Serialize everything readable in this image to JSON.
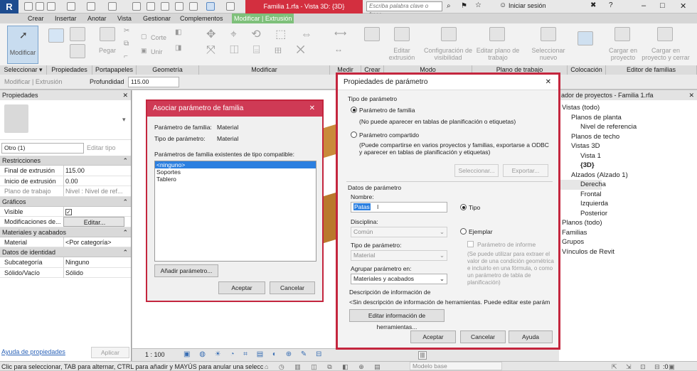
{
  "titlebar": {
    "logo": "R",
    "window_title": "Familia 1.rfa - Vista 3D: {3D}",
    "search_placeholder": "Escriba palabra clave o frase",
    "sign_in": "Iniciar sesión",
    "win_min": "–",
    "win_max": "□",
    "win_close": "✕"
  },
  "tabs": [
    "Crear",
    "Insertar",
    "Anotar",
    "Vista",
    "Gestionar",
    "Complementos",
    "Modificar | Extrusión"
  ],
  "ribbon": {
    "modify": "Modificar",
    "properties_btn": "Propiedades",
    "paste": "Pegar",
    "cut": "Corte",
    "join": "Unir",
    "edit_extrusion": "Editar extrusión",
    "visibility": "Configuración de visibilidad",
    "edit_workplane": "Editar plano de trabajo",
    "select_new": "Seleccionar nuevo",
    "load_project": "Cargar en proyecto",
    "load_close": "Cargar en proyecto y cerrar",
    "panels": [
      "Seleccionar ▾",
      "Propiedades",
      "Portapapeles",
      "Geometría",
      "Modificar",
      "Medir",
      "Crear",
      "Modo",
      "Plano de trabajo",
      "Colocación",
      "Editor de familias"
    ]
  },
  "optbar": {
    "context": "Modificar | Extrusión",
    "depth_label": "Profundidad",
    "depth_value": "115.00"
  },
  "properties": {
    "title": "Propiedades",
    "close": "✕",
    "type_selector": "Otro (1)",
    "edit_type": "Editar tipo",
    "sections": {
      "constraints": "Restricciones",
      "graphics": "Gráficos",
      "materials": "Materiales y acabados",
      "identity": "Datos de identidad"
    },
    "rows": {
      "extrusion_end": {
        "k": "Final de extrusión",
        "v": "115.00"
      },
      "extrusion_start": {
        "k": "Inicio de extrusión",
        "v": "0.00"
      },
      "work_plane": {
        "k": "Plano de trabajo",
        "v": "Nivel : Nivel de ref..."
      },
      "visible": {
        "k": "Visible",
        "v": "✓"
      },
      "overrides": {
        "k": "Modificaciones de...",
        "v": "Editar..."
      },
      "material": {
        "k": "Material",
        "v": "<Por categoría>"
      },
      "subcategory": {
        "k": "Subcategoría",
        "v": "Ninguno"
      },
      "solid_void": {
        "k": "Sólido/Vacío",
        "v": "Sólido"
      }
    },
    "help_link": "Ayuda de propiedades",
    "apply": "Aplicar"
  },
  "browser": {
    "title": "ador de proyectos - Familia 1.rfa",
    "close": "✕",
    "items": [
      {
        "t": "Vistas (todo)",
        "i": 0
      },
      {
        "t": "Planos de planta",
        "i": 1
      },
      {
        "t": "Nivel de referencia",
        "i": 2
      },
      {
        "t": "Planos de techo",
        "i": 1
      },
      {
        "t": "Vistas 3D",
        "i": 1
      },
      {
        "t": "Vista 1",
        "i": 2
      },
      {
        "t": "{3D}",
        "i": 2,
        "bold": true
      },
      {
        "t": "Alzados (Alzado 1)",
        "i": 1
      },
      {
        "t": "Derecha",
        "i": 2,
        "sel": true
      },
      {
        "t": "Frontal",
        "i": 2
      },
      {
        "t": "Izquierda",
        "i": 2
      },
      {
        "t": "Posterior",
        "i": 2
      },
      {
        "t": "Planos (todo)",
        "i": 0
      },
      {
        "t": "Familias",
        "i": 0
      },
      {
        "t": "Grupos",
        "i": 0
      },
      {
        "t": "Vínculos de Revit",
        "i": 0
      }
    ]
  },
  "viewbar": {
    "scale": "1 : 100"
  },
  "status": {
    "hint": "Clic para seleccionar, TAB para alternar, CTRL para añadir y MAYÚS para anular una selecc",
    "model": "Modelo base",
    "filter": ":0"
  },
  "assoc_dialog": {
    "title": "Asociar parámetro de familia",
    "close": "✕",
    "param_label": "Parámetro de familia:",
    "param_value": "Material",
    "type_label": "Tipo de parámetro:",
    "type_value": "Material",
    "list_label": "Parámetros de familia existentes de tipo compatible:",
    "list": [
      "<ninguno>",
      "Soportes",
      "Tablero"
    ],
    "add_param": "Añadir parámetro...",
    "accept": "Aceptar",
    "cancel": "Cancelar"
  },
  "param_dialog": {
    "title": "Propiedades de parámetro",
    "close": "✕",
    "type_group": "Tipo de parámetro",
    "family_param": "Parámetro de familia",
    "family_note": "(No puede aparecer en tablas de planificación o etiquetas)",
    "shared_param": "Parámetro compartido",
    "shared_note": "(Puede compartirse en varios proyectos y familias, exportarse a ODBC y aparecer en tablas de planificación y etiquetas)",
    "select": "Seleccionar...",
    "export": "Exportar...",
    "data_group": "Datos de parámetro",
    "name_label": "Nombre:",
    "name_value": "Patas",
    "type_radio": "Tipo",
    "instance_radio": "Ejemplar",
    "discipline_label": "Disciplina:",
    "discipline_value": "Común",
    "param_type_label": "Tipo de parámetro:",
    "param_type_value": "Material",
    "report_param": "Parámetro de informe",
    "report_note": "(Se puede utilizar para extraer el valor de una condición geométrica e incluirlo en una fórmula, o como un parámetro de tabla de planificación)",
    "group_label": "Agrupar parámetro en:",
    "group_value": "Materiales y acabados",
    "tooltip_label": "Descripción de información de",
    "tooltip_value": "<Sin descripción de información de herramientas. Puede editar este parámet...",
    "edit_tooltip": "Editar información de herramientas...",
    "accept": "Aceptar",
    "cancel": "Cancelar",
    "help": "Ayuda"
  }
}
